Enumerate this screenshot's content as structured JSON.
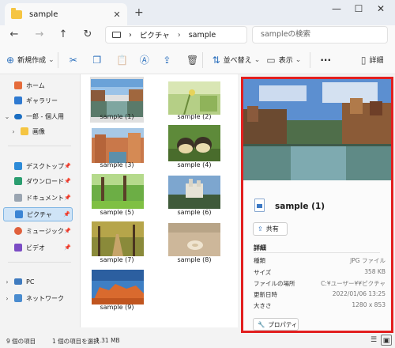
{
  "window": {
    "tab_title": "sample",
    "tab_close": "✕",
    "new_tab": "+",
    "minimize": "—",
    "maximize": "☐",
    "close": "✕"
  },
  "nav": {
    "back": "←",
    "forward": "→",
    "up": "↑",
    "refresh": "↻",
    "breadcrumb": [
      "ピクチャ",
      "sample"
    ],
    "breadcrumb_sep": "›",
    "search_placeholder": "sampleの検索"
  },
  "toolbar": {
    "new_label": "新規作成",
    "sort_label": "並べ替え",
    "view_label": "表示",
    "more": "···",
    "details_label": "詳細",
    "new_icon": "⊕",
    "cut_icon": "✂",
    "copy_icon": "❐",
    "paste_icon": "📋",
    "rename_icon": "Ⓐ",
    "share_icon": "⇪",
    "delete_icon": "🗑",
    "sort_icon": "⇅",
    "view_icon": "▭",
    "details_icon": "▯",
    "dropdown": "⌄"
  },
  "sidebar": {
    "items": [
      {
        "label": "ホーム",
        "color": "#e56b3a"
      },
      {
        "label": "ギャラリー",
        "color": "#2f7ad1"
      },
      {
        "label": "一郎 - 個人用",
        "color": "#1b6ec2"
      },
      {
        "label": "画像",
        "color": "#f5c542"
      },
      {
        "label": "デスクトップ",
        "color": "#2d8bd8"
      },
      {
        "label": "ダウンロード",
        "color": "#2a9d6f"
      },
      {
        "label": "ドキュメント",
        "color": "#9aa5b1"
      },
      {
        "label": "ピクチャ",
        "color": "#3a84d4"
      },
      {
        "label": "ミュージック",
        "color": "#e0603c"
      },
      {
        "label": "ビデオ",
        "color": "#7b4cc4"
      },
      {
        "label": "PC",
        "color": "#3f7bbf"
      },
      {
        "label": "ネットワーク",
        "color": "#4a8ccf"
      }
    ],
    "chev_right": "›",
    "chev_down": "⌄",
    "pin": "📌"
  },
  "files": [
    {
      "name": "sample (1)"
    },
    {
      "name": "sample (2)"
    },
    {
      "name": "sample (3)"
    },
    {
      "name": "sample (4)"
    },
    {
      "name": "sample (5)"
    },
    {
      "name": "sample (6)"
    },
    {
      "name": "sample (7)"
    },
    {
      "name": "sample (8)"
    },
    {
      "name": "sample (9)"
    }
  ],
  "preview": {
    "file_name": "sample (1)",
    "share_label": "共有",
    "share_icon": "⇪",
    "details_heading": "詳細",
    "properties": [
      {
        "key": "種類",
        "value": "JPG ファイル"
      },
      {
        "key": "サイズ",
        "value": "358 KB"
      },
      {
        "key": "ファイルの場所",
        "value": "C:¥ユーザー¥¥ピクチャ"
      },
      {
        "key": "更新日時",
        "value": "2022/01/06 13:25"
      },
      {
        "key": "大きさ",
        "value": "1280 x 853"
      }
    ],
    "properties_label": "プロパティ",
    "properties_icon": "🔧"
  },
  "status": {
    "item_count": "9 個の項目",
    "selection": "1 個の項目を選択",
    "size": "1.31 MB",
    "details_view_icon": "☰",
    "preview_view_icon": "▣"
  },
  "colors": {
    "accent": "#2a6fbd",
    "highlight_border": "#e21f1f",
    "selected_nav": "#cfe4f7"
  }
}
